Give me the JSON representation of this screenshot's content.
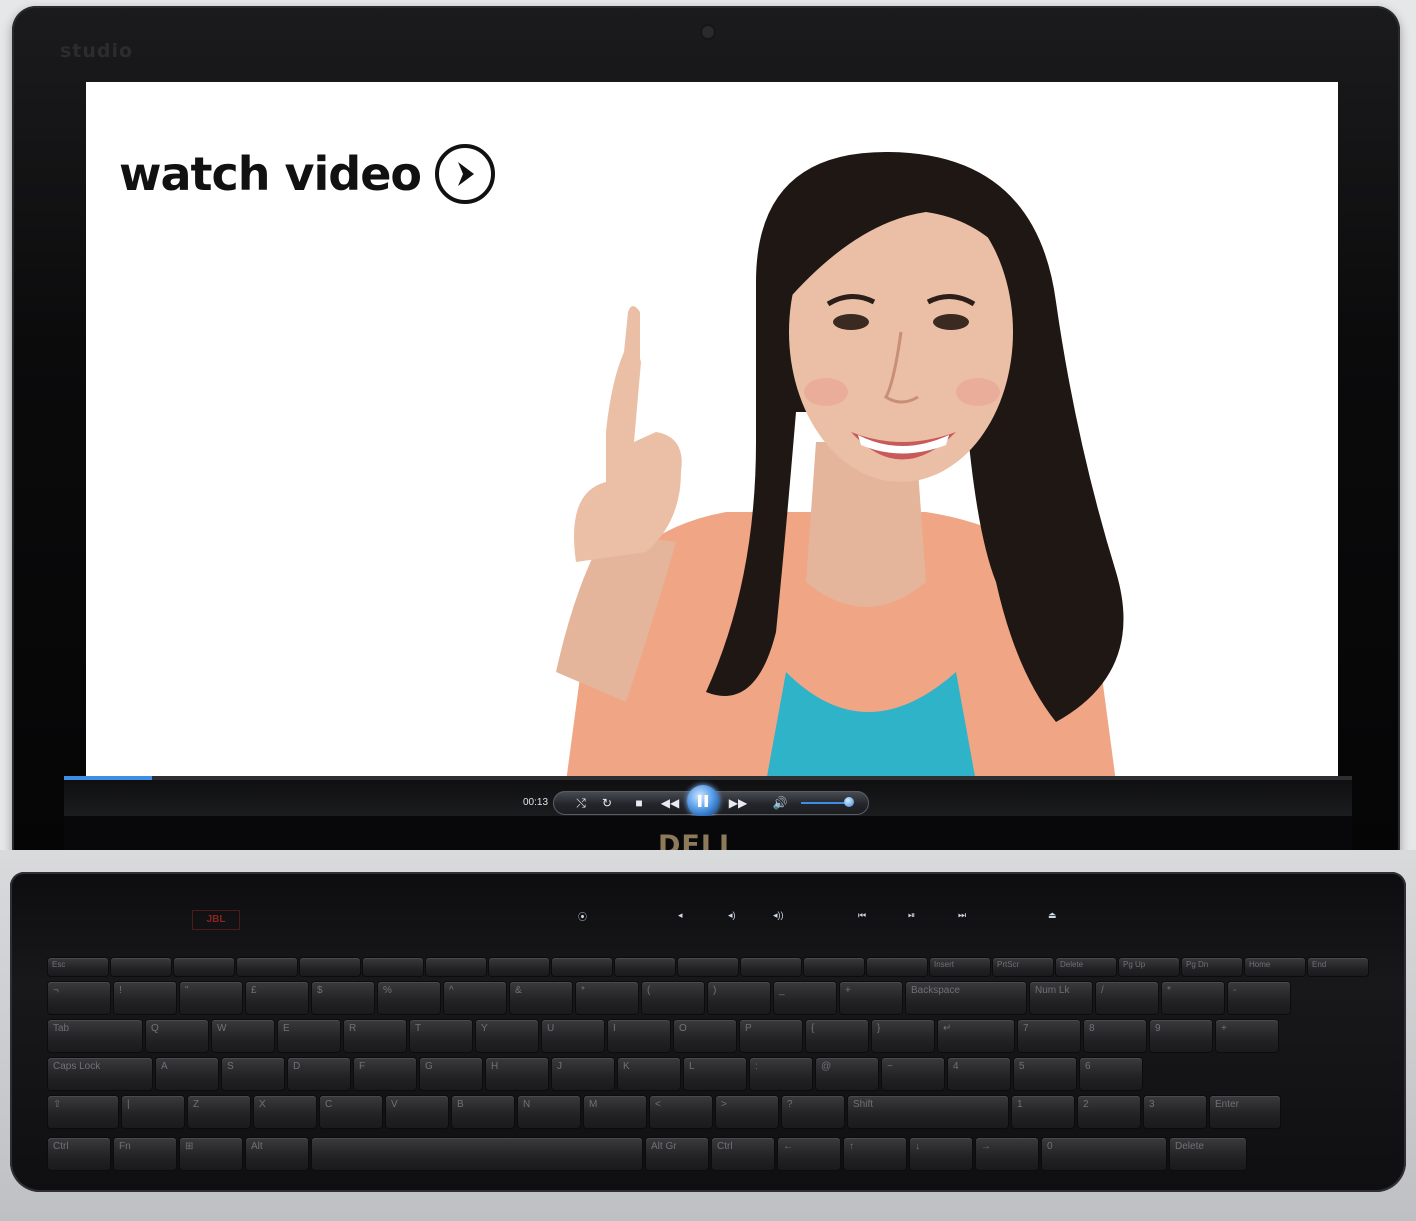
{
  "laptop": {
    "brand_badge": "studio",
    "maker_logo": "DELL"
  },
  "screen": {
    "overlay_label": "watch video",
    "overlay_icon": "play-circle-icon"
  },
  "player": {
    "time": "00:13",
    "progress_fraction": 0.068,
    "volume_fraction": 0.95,
    "controls": {
      "shuffle_icon": "shuffle-icon",
      "repeat_icon": "repeat-icon",
      "stop_icon": "stop-icon",
      "rewind_icon": "rewind-icon",
      "pause_icon": "pause-icon",
      "fast_forward_icon": "fast-forward-icon",
      "volume_icon": "volume-icon"
    },
    "accent": "#3f8ee6"
  },
  "keyboard": {
    "speaker_badge": "JBL",
    "function_row": [
      "Esc",
      "",
      "",
      "",
      "",
      "",
      "",
      "",
      "",
      "",
      "",
      "",
      "",
      "",
      "Insert",
      "PrtScr",
      "Delete",
      "Pg Up",
      "Pg Dn",
      "Home",
      "End"
    ],
    "number_row": [
      "¬",
      "!",
      "\"",
      "£",
      "$",
      "%",
      "^",
      "&",
      "*",
      "(",
      ")",
      "_",
      "+",
      "Backspace",
      "Num Lk",
      "/",
      "*",
      "-"
    ],
    "top_row": [
      "Tab",
      "Q",
      "W",
      "E",
      "R",
      "T",
      "Y",
      "U",
      "I",
      "O",
      "P",
      "{",
      "}",
      "↵",
      "7",
      "8",
      "9",
      "+"
    ],
    "home_row": [
      "Caps Lock",
      "A",
      "S",
      "D",
      "F",
      "G",
      "H",
      "J",
      "K",
      "L",
      ":",
      "@",
      "~",
      "4",
      "5",
      "6"
    ],
    "bottom_row": [
      "⇧",
      "|",
      "Z",
      "X",
      "C",
      "V",
      "B",
      "N",
      "M",
      "<",
      ">",
      "?",
      "Shift",
      "1",
      "2",
      "3",
      "Enter"
    ],
    "space_row": [
      "Ctrl",
      "Fn",
      "⊞",
      "Alt",
      "",
      "Alt Gr",
      "Ctrl",
      "←",
      "↑",
      "↓",
      "→",
      "0",
      "Delete"
    ]
  }
}
